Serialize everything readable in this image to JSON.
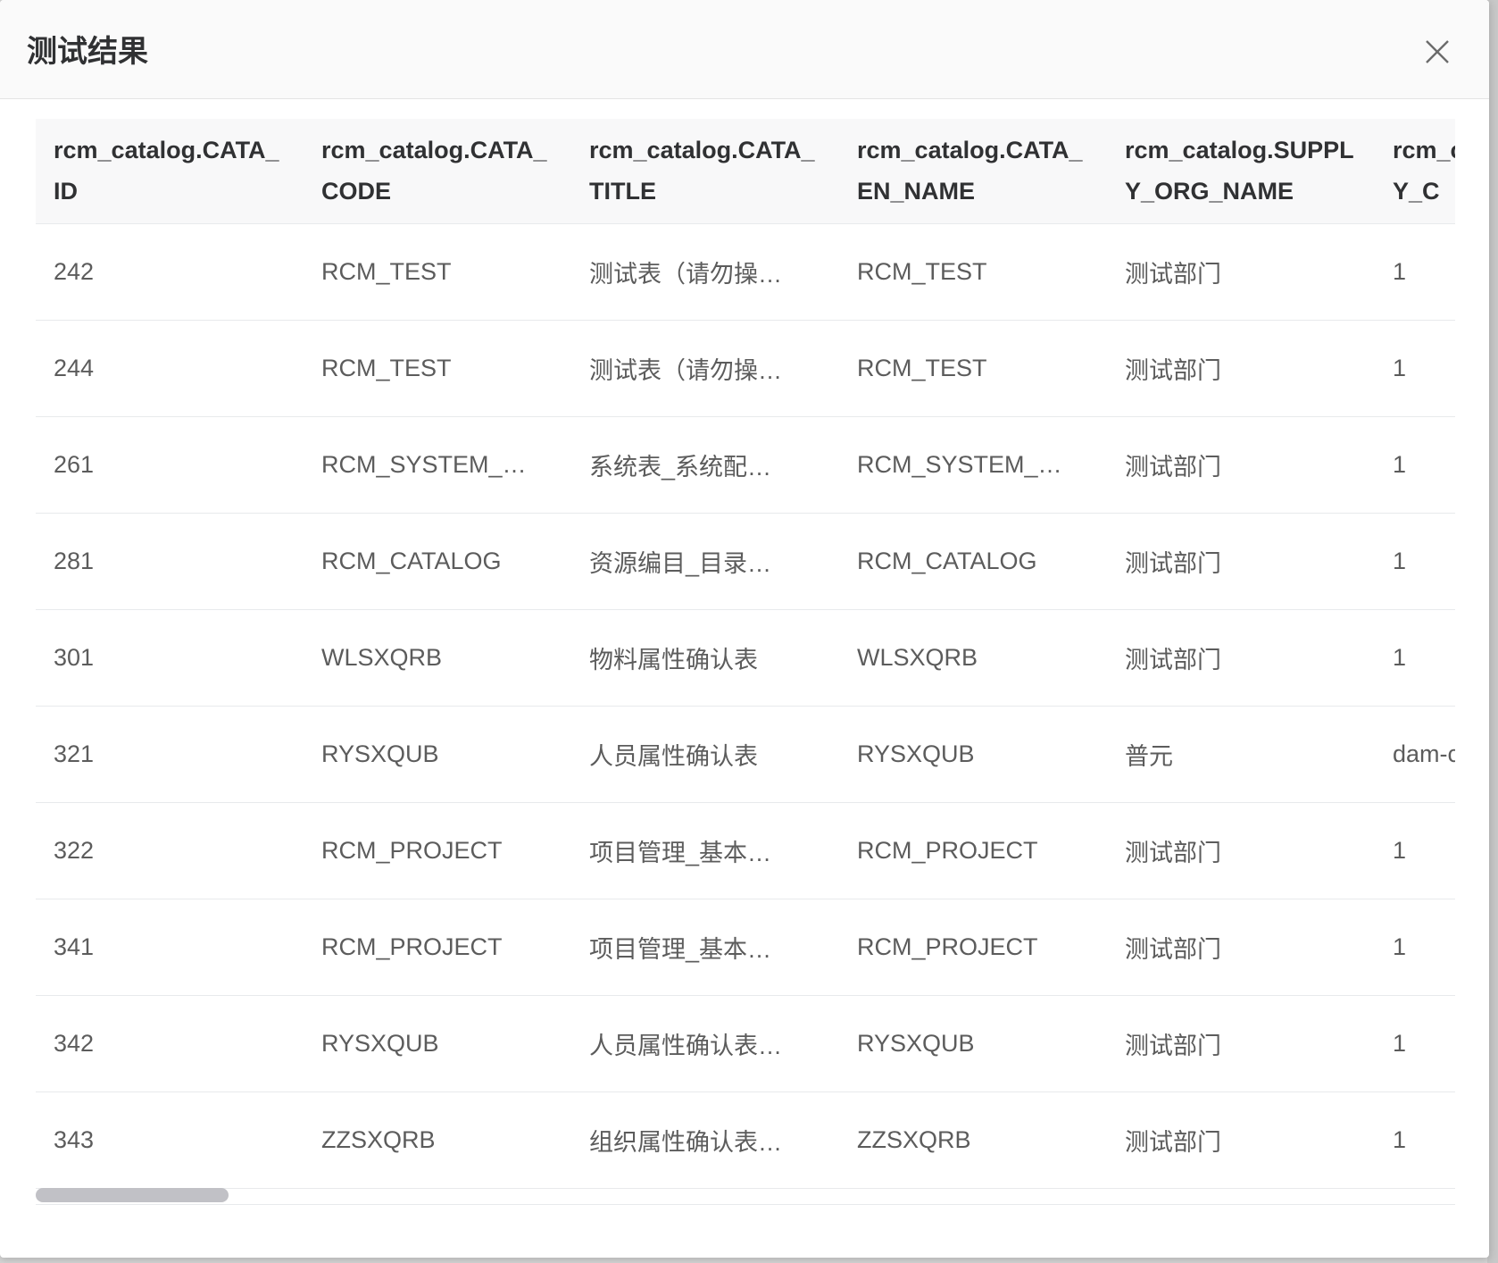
{
  "modal": {
    "title": "测试结果"
  },
  "table": {
    "columns": [
      "rcm_catalog.CATA_ID",
      "rcm_catalog.CATA_CODE",
      "rcm_catalog.CATA_TITLE",
      "rcm_catalog.CATA_EN_NAME",
      "rcm_catalog.SUPPLY_ORG_NAME",
      "rcm_catalog.SUPPLY_C"
    ],
    "rows": [
      [
        "242",
        "RCM_TEST",
        "测试表（请勿操…",
        "RCM_TEST",
        "测试部门",
        "1"
      ],
      [
        "244",
        "RCM_TEST",
        "测试表（请勿操…",
        "RCM_TEST",
        "测试部门",
        "1"
      ],
      [
        "261",
        "RCM_SYSTEM_…",
        "系统表_系统配…",
        "RCM_SYSTEM_…",
        "测试部门",
        "1"
      ],
      [
        "281",
        "RCM_CATALOG",
        "资源编目_目录…",
        "RCM_CATALOG",
        "测试部门",
        "1"
      ],
      [
        "301",
        "WLSXQRB",
        "物料属性确认表",
        "WLSXQRB",
        "测试部门",
        "1"
      ],
      [
        "321",
        "RYSXQUB",
        "人员属性确认表",
        "RYSXQUB",
        "普元",
        "dam-c"
      ],
      [
        "322",
        "RCM_PROJECT",
        "项目管理_基本…",
        "RCM_PROJECT",
        "测试部门",
        "1"
      ],
      [
        "341",
        "RCM_PROJECT",
        "项目管理_基本…",
        "RCM_PROJECT",
        "测试部门",
        "1"
      ],
      [
        "342",
        "RYSXQUB",
        "人员属性确认表…",
        "RYSXQUB",
        "测试部门",
        "1"
      ],
      [
        "343",
        "ZZSXQRB",
        "组织属性确认表…",
        "ZZSXQRB",
        "测试部门",
        "1"
      ]
    ]
  },
  "icons": {
    "close": "close-icon"
  },
  "colors": {
    "header_bg": "#f8f8f9",
    "text": "#5c5c5c",
    "title": "#303133",
    "scroll_thumb": "#c1c1c6"
  }
}
